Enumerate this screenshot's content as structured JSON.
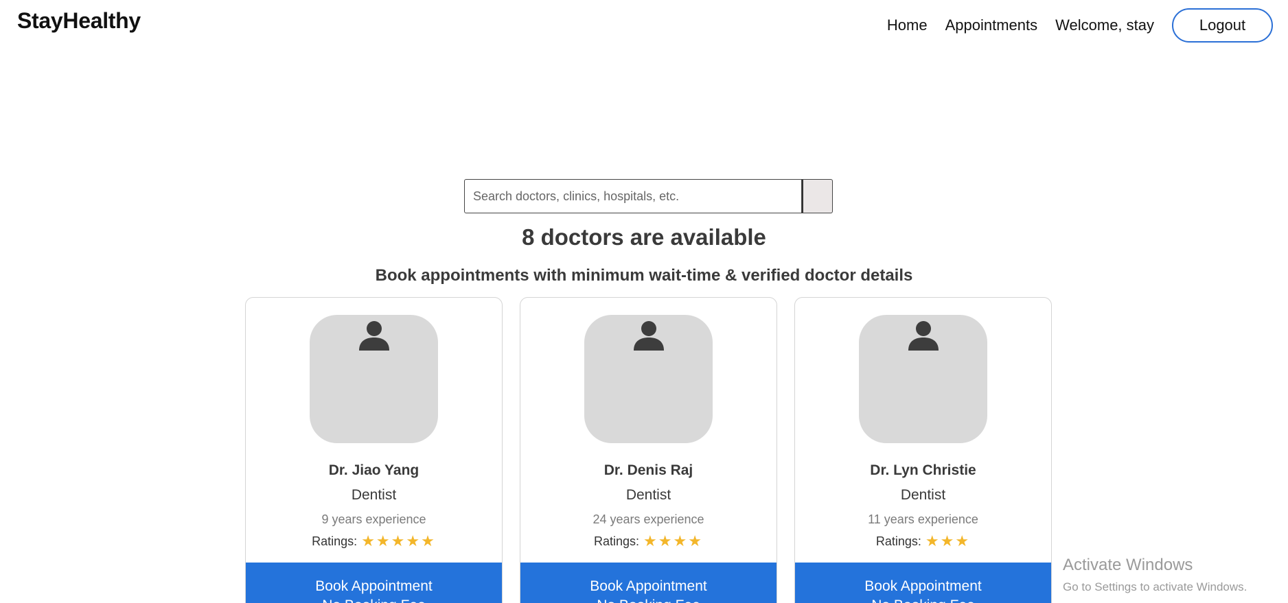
{
  "nav": {
    "logo": "StayHealthy",
    "links": [
      "Home",
      "Appointments",
      "Welcome, stay"
    ],
    "logout": "Logout"
  },
  "search": {
    "placeholder": "Search doctors, clinics, hospitals, etc.",
    "value": ""
  },
  "headline": {
    "count": "8 doctors are available",
    "subtitle": "Book appointments with minimum wait-time & verified doctor details"
  },
  "doctors": [
    {
      "name": "Dr. Jiao Yang",
      "specialty": "Dentist",
      "experience": "9 years experience",
      "ratings_label": "Ratings:",
      "stars": 5
    },
    {
      "name": "Dr. Denis Raj",
      "specialty": "Dentist",
      "experience": "24 years experience",
      "ratings_label": "Ratings:",
      "stars": 4
    },
    {
      "name": "Dr. Lyn Christie",
      "specialty": "Dentist",
      "experience": "11 years experience",
      "ratings_label": "Ratings:",
      "stars": 3
    }
  ],
  "book_button": {
    "line1": "Book Appointment",
    "line2": "No Booking Fee"
  },
  "watermark": {
    "title": "Activate Windows",
    "subtitle": "Go to Settings to activate Windows."
  },
  "colors": {
    "accent": "#2473db",
    "star": "#f3b62a",
    "avatar_bg": "#d9d9d9"
  },
  "icons": {
    "avatar": "user-silhouette-icon",
    "rating": "star-icon"
  }
}
